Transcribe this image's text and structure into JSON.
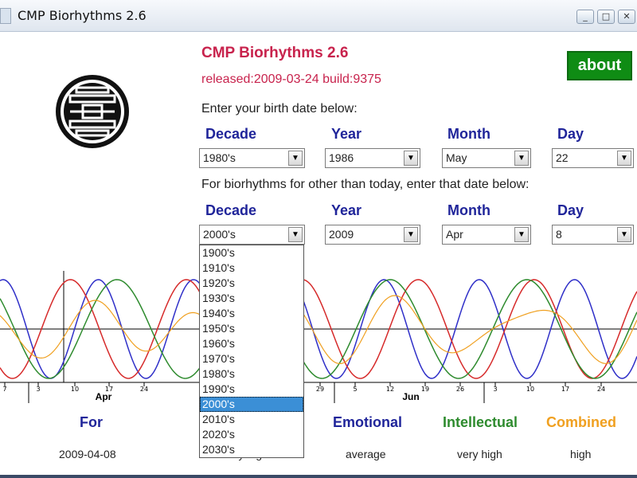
{
  "window": {
    "title": "CMP Biorhythms 2.6",
    "minimize": "_",
    "maximize": "□",
    "close": "✕"
  },
  "header": {
    "app_title": "CMP Biorhythms 2.6",
    "release": "released:2009-03-24 build:9375",
    "about": "about"
  },
  "birth": {
    "prompt": "Enter your birth date below:",
    "labels": {
      "decade": "Decade",
      "year": "Year",
      "month": "Month",
      "day": "Day"
    },
    "values": {
      "decade": "1980's",
      "year": "1986",
      "month": "May",
      "day": "22"
    }
  },
  "target": {
    "prompt": "For biorhythms for other than today, enter that date below:",
    "labels": {
      "decade": "Decade",
      "year": "Year",
      "month": "Month",
      "day": "Day"
    },
    "values": {
      "decade": "2000's",
      "year": "2009",
      "month": "Apr",
      "day": "8"
    }
  },
  "decade_options": [
    "1900's",
    "1910's",
    "1920's",
    "1930's",
    "1940's",
    "1950's",
    "1960's",
    "1970's",
    "1980's",
    "1990's",
    "2000's",
    "2010's",
    "2020's",
    "2030's"
  ],
  "decade_selected": "2000's",
  "colors": {
    "physical": "#2f2fc8",
    "emotional": "#d62a2a",
    "intellectual": "#2e8b2e",
    "combined": "#f0a020",
    "accent": "#c8234d",
    "label": "#20259a",
    "about": "#0f8c14"
  },
  "chart_data": {
    "type": "line",
    "x_ticks": [
      "7",
      "3",
      "10",
      "17",
      "24",
      "29",
      "5",
      "12",
      "19",
      "26",
      "3",
      "10",
      "17",
      "24"
    ],
    "month_labels": [
      "Apr",
      "Jun"
    ],
    "series_periods_days": {
      "physical": 23,
      "emotional": 28,
      "intellectual": 33
    },
    "ylim": [
      -1,
      1
    ]
  },
  "legend": {
    "for": "For",
    "emotional": "Emotional",
    "intellectual": "Intellectual",
    "combined": "Combined"
  },
  "values": {
    "date": "2009-04-08",
    "physical": "very high",
    "emotional": "average",
    "intellectual": "very high",
    "combined": "high"
  }
}
